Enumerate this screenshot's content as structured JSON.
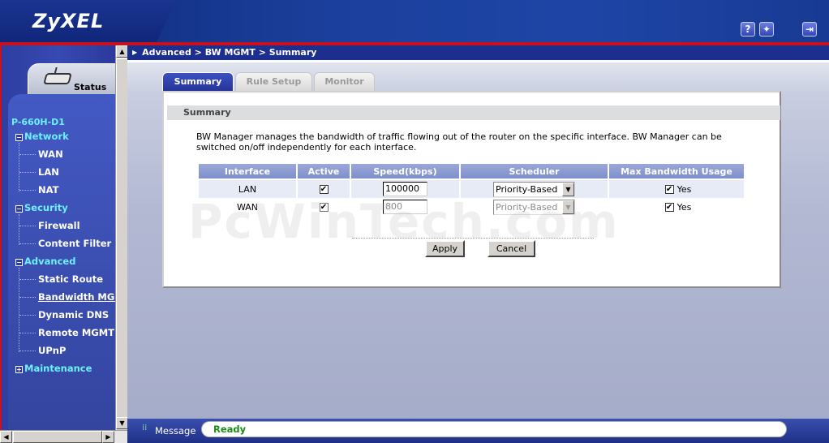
{
  "header": {
    "logo": "ZyXEL",
    "help_icon": "?",
    "wizard_icon": "wizard-icon",
    "logout_icon": "logout-icon"
  },
  "sidebar": {
    "status_label": "Status",
    "device_name": "P-660H-D1",
    "groups": [
      {
        "label": "Network",
        "expander": "−",
        "items": [
          "WAN",
          "LAN",
          "NAT"
        ]
      },
      {
        "label": "Security",
        "expander": "−",
        "items": [
          "Firewall",
          "Content Filter"
        ]
      },
      {
        "label": "Advanced",
        "expander": "−",
        "items": [
          "Static Route",
          "Bandwidth MGMT",
          "Dynamic DNS",
          "Remote MGMT",
          "UPnP"
        ]
      },
      {
        "label": "Maintenance",
        "expander": "+",
        "items": []
      }
    ],
    "active_item": "Bandwidth MGMT"
  },
  "breadcrumb": "Advanced > BW MGMT > Summary",
  "tabs": [
    {
      "label": "Summary",
      "active": true
    },
    {
      "label": "Rule Setup",
      "active": false
    },
    {
      "label": "Monitor",
      "active": false
    }
  ],
  "section_title": "Summary",
  "description": "BW Manager manages the bandwidth of traffic flowing out of the router on the specific interface. BW Manager can be switched on/off independently for each interface.",
  "table": {
    "headers": [
      "Interface",
      "Active",
      "Speed(kbps)",
      "Scheduler",
      "Max Bandwidth Usage"
    ],
    "rows": [
      {
        "interface": "LAN",
        "active": true,
        "speed": "100000",
        "scheduler": "Priority-Based",
        "max_bw": true,
        "max_bw_label": "Yes",
        "enabled": true
      },
      {
        "interface": "WAN",
        "active": true,
        "speed": "800",
        "scheduler": "Priority-Based",
        "max_bw": true,
        "max_bw_label": "Yes",
        "enabled": false
      }
    ]
  },
  "buttons": {
    "apply": "Apply",
    "cancel": "Cancel"
  },
  "watermark": "PcWinTech.com",
  "message": {
    "label": "Message",
    "value": "Ready"
  },
  "colors": {
    "header": "#1b3f9c",
    "accent_red": "#c8101e",
    "nav_group": "#6df0ff",
    "status_ok": "#1a8a1a"
  }
}
